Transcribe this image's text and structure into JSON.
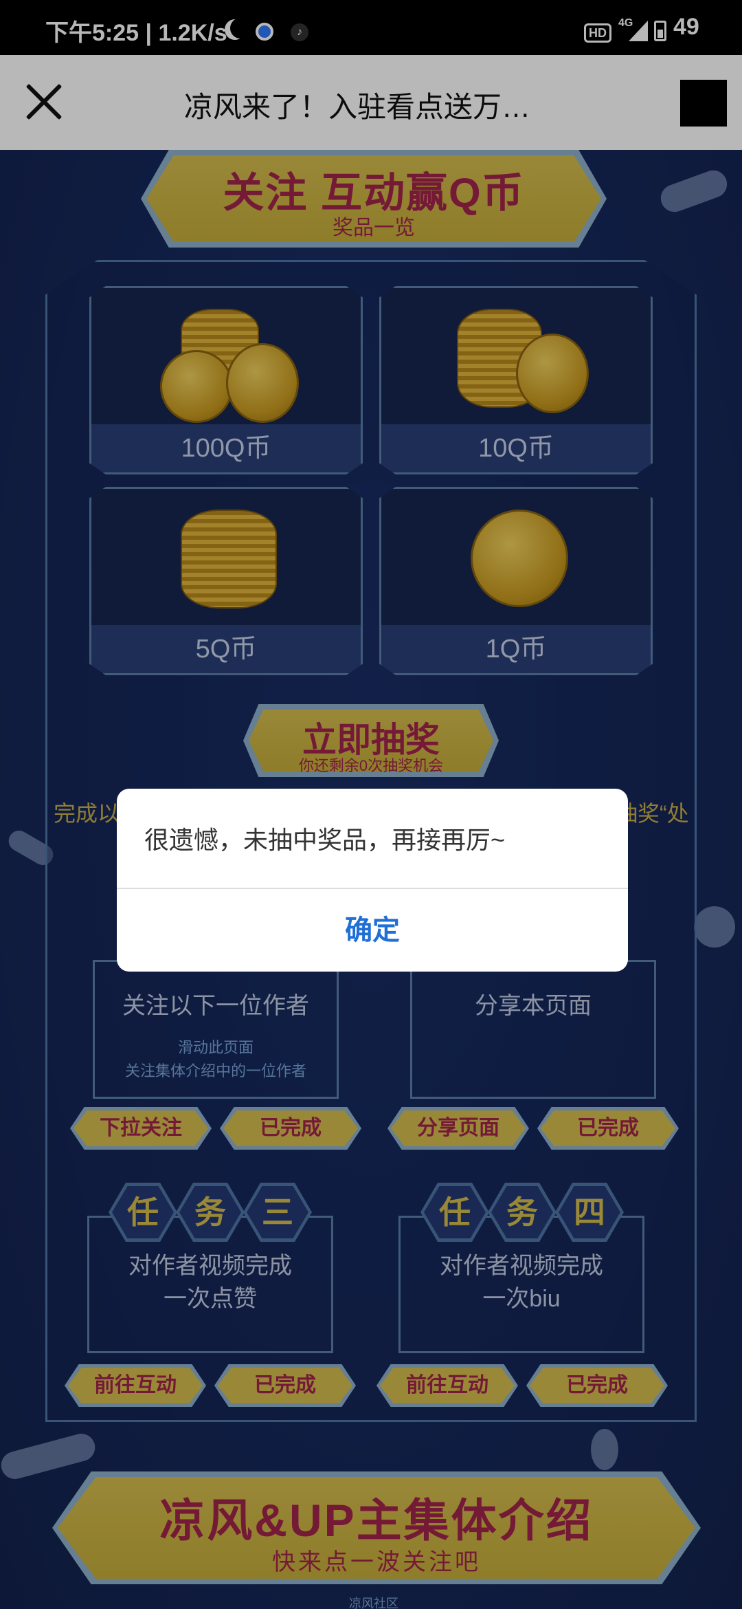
{
  "status_bar": {
    "time": "下午5:25 | 1.2K/s",
    "hd": "HD",
    "network": "4G",
    "battery": "49"
  },
  "title_bar": {
    "title": "凉风来了！入驻看点送万…"
  },
  "banner_top": {
    "title": "关注 互动赢Q币",
    "subtitle": "奖品一览"
  },
  "prizes": [
    {
      "label": "100Q币"
    },
    {
      "label": "10Q币"
    },
    {
      "label": "5Q币"
    },
    {
      "label": "1Q币"
    }
  ],
  "lottery": {
    "title": "立即抽奖",
    "subtitle": "你还剩余0次抽奖机会"
  },
  "note_left": "完成以",
  "note_right": "抽奖“处",
  "tasks": {
    "task1": {
      "text": "关注以下一位作者",
      "sub1": "滑动此页面",
      "sub2": "关注集体介绍中的一位作者",
      "btn1": "下拉关注",
      "btn2": "已完成"
    },
    "task2": {
      "text": "分享本页面",
      "btn1": "分享页面",
      "btn2": "已完成"
    },
    "task3": {
      "hex": [
        "任",
        "务",
        "三"
      ],
      "line1": "对作者视频完成",
      "line2": "一次点赞",
      "btn1": "前往互动",
      "btn2": "已完成"
    },
    "task4": {
      "hex": [
        "任",
        "务",
        "四"
      ],
      "line1": "对作者视频完成",
      "line2": "一次biu",
      "btn1": "前往互动",
      "btn2": "已完成"
    }
  },
  "banner_bottom": {
    "title": "凉风&UP主集体介绍",
    "subtitle": "快来点一波关注吧"
  },
  "footer_text": "凉风社区",
  "dialog": {
    "message": "很遗憾，未抽中奖品，再接再厉~",
    "ok": "确定"
  },
  "colors": {
    "accent_gold": "#d4bd4e",
    "accent_magenta": "#a2254c",
    "link_blue": "#1f6fd6",
    "bg_navy": "#162651"
  }
}
